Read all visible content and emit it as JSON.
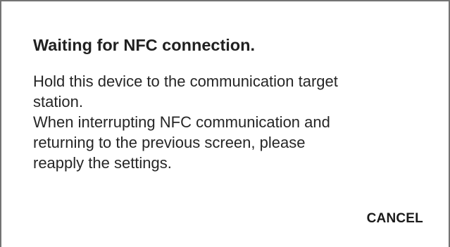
{
  "dialog": {
    "title": "Waiting for NFC connection.",
    "message_lines": [
      "Hold this device to the communication target",
      "station.",
      "When interrupting NFC communication and",
      "returning to the previous screen, please",
      "reapply the settings."
    ],
    "cancel_label": "CANCEL"
  }
}
